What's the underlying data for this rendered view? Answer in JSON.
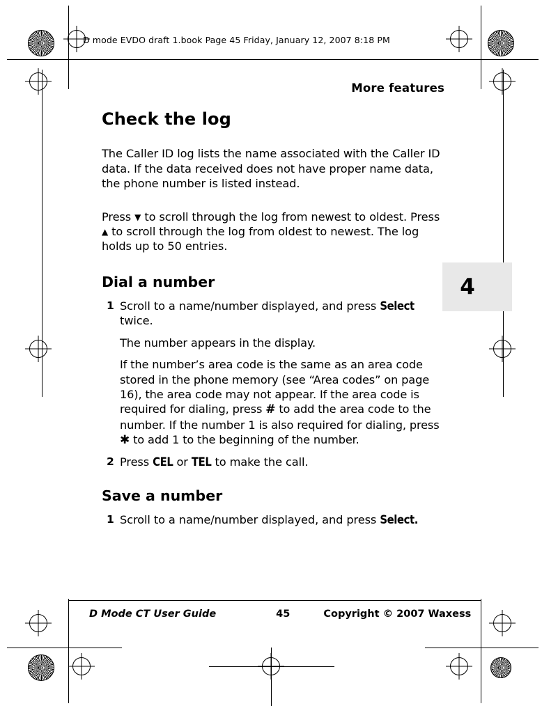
{
  "header": {
    "file_strip": "D mode EVDO draft 1.book  Page 45  Friday, January 12, 2007  8:18 PM"
  },
  "running_head": "More features",
  "chapter_tab": {
    "number": "4"
  },
  "sections": [
    {
      "title": "Check the log",
      "paragraphs": [
        "The Caller ID log lists the name associated with the Caller ID data. If the data received does not have proper name data, the phone number is listed instead.",
        "Press ▼ to scroll through the log from newest to oldest. Press ▲ to scroll through the log from oldest to newest. The log holds up to 50 entries."
      ]
    },
    {
      "title": "Dial a number",
      "steps": [
        {
          "number": "1",
          "text_before": "Scroll to a name/number displayed, and press ",
          "softkey": "Select",
          "text_after": " twice.",
          "substeps": [
            "The number appears in the display.",
            "If the number’s area code is the same as an area code stored in the phone memory (see “Area codes” on page 16), the area code may not appear. If the area code is required for dialing, press # to add the area code to the number. If the number 1 is also required for dialing, press ✱ to add 1 to the beginning of the number."
          ]
        },
        {
          "number": "2",
          "text_before": "Press ",
          "softkey": "CEL",
          "text_middle": " or ",
          "softkey2": "TEL",
          "text_after": " to make the call."
        }
      ]
    },
    {
      "title": "Save a number",
      "steps": [
        {
          "number": "1",
          "text_before": "Scroll to a name/number displayed, and press ",
          "softkey": "Select.",
          "text_after": ""
        }
      ]
    }
  ],
  "footer": {
    "guide": "D Mode CT User Guide",
    "page_number": "45",
    "copyright": "Copyright © 2007 Waxess"
  },
  "icons": {
    "scroll_down": "▼",
    "scroll_up": "▲",
    "pound_key": "#",
    "star_key": "✱"
  }
}
